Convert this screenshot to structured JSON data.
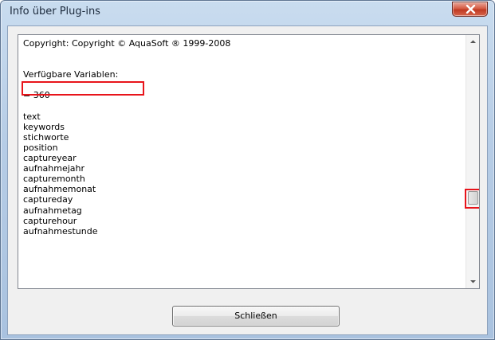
{
  "window": {
    "title": "Info über Plug-ins",
    "close_icon": "close-x-icon"
  },
  "content": {
    "copyright": "Copyright: Copyright © AquaSoft ® 1999-2008",
    "variables_heading": "Verfügbare Variablen:",
    "count_line": "= 360",
    "variables": [
      "text",
      "keywords",
      "stichworte",
      "position",
      "captureyear",
      "aufnahmejahr",
      "capturemonth",
      "aufnahmemonat",
      "captureday",
      "aufnahmetag",
      "capturehour",
      "aufnahmestunde"
    ]
  },
  "buttons": {
    "close_label": "Schließen"
  },
  "colors": {
    "highlight": "#e8141b",
    "titlebar": "#b7cde6",
    "close_button": "#c03a22"
  }
}
